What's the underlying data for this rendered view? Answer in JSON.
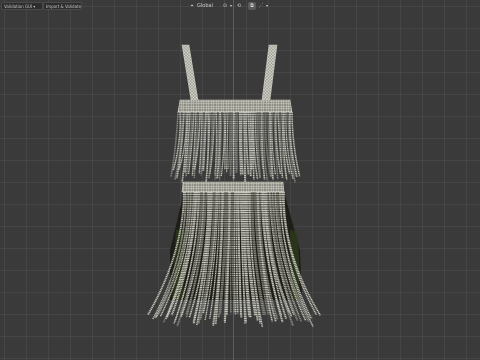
{
  "header": {
    "validation_menu_label": "Validation GUI",
    "import_button_label": "Import & Validate"
  },
  "transform_bar": {
    "orientation_label": "Global",
    "icons": [
      "transform-axes-icon",
      "pivot-point-icon",
      "snap-icon",
      "snap-toggle-icon",
      "snap-element-icon"
    ]
  },
  "viewport": {
    "object": "dress-fringe-wireframe",
    "colors": {
      "background": "#3a3a3a",
      "grid": "#454545",
      "axis": "#4f6f98",
      "mesh": "#c2c2b8",
      "mesh_shadow": "#7c7c74",
      "interior": "#1a1a16"
    }
  }
}
